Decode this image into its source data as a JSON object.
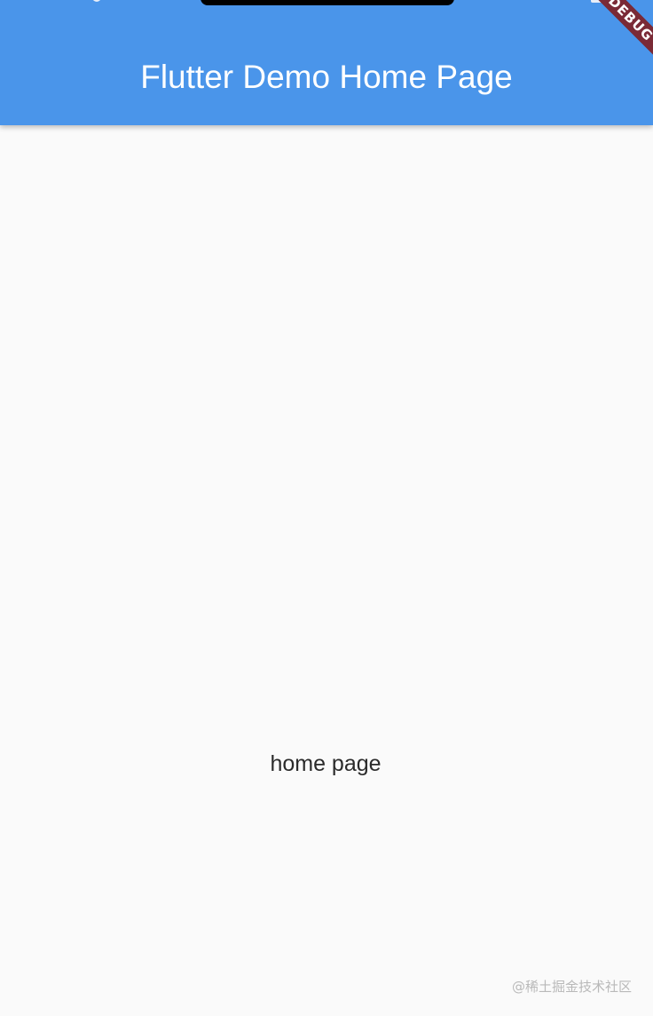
{
  "app_bar": {
    "title": "Flutter Demo Home Page",
    "color": "#4a95ea"
  },
  "debug_banner": {
    "label": "DEBUG",
    "color": "#7a2a36"
  },
  "body": {
    "text": "home page",
    "background": "#fafafa"
  },
  "watermark": {
    "text": "@稀土掘金技术社区"
  }
}
